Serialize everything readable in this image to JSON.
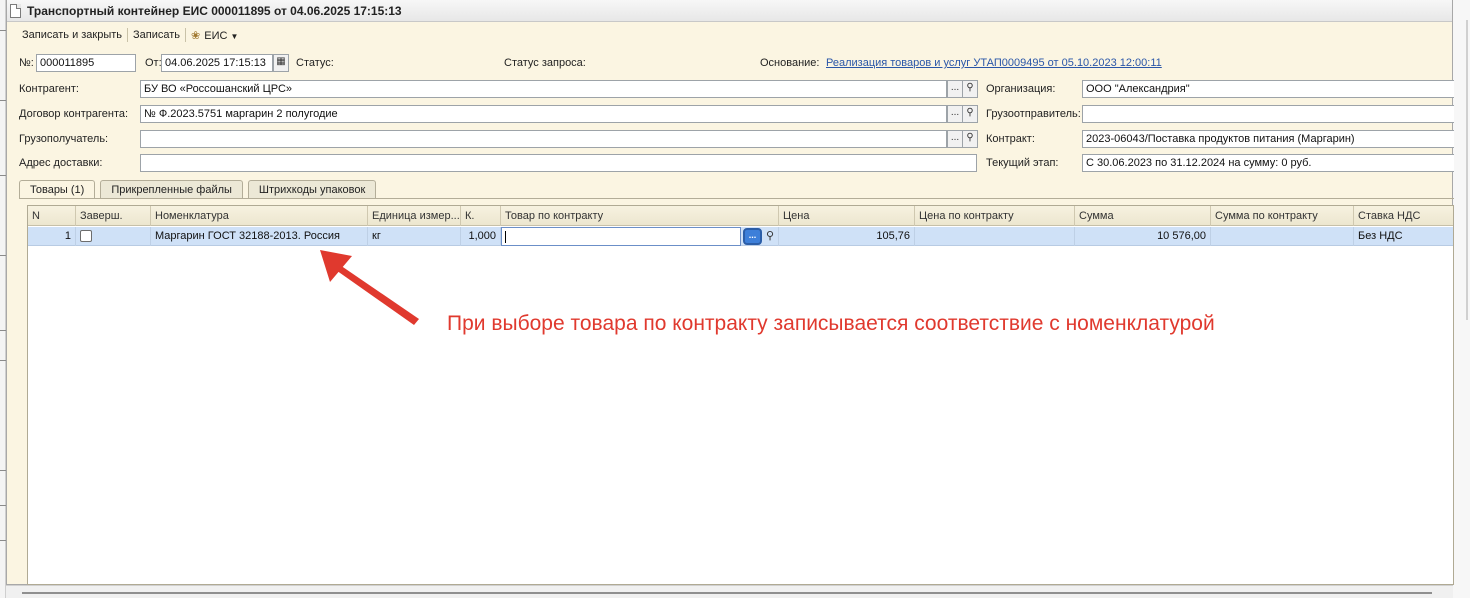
{
  "window": {
    "title": "Транспортный контейнер ЕИС 000011895 от 04.06.2025 17:15:13"
  },
  "toolbar": {
    "save_close": "Записать и закрыть",
    "save": "Записать",
    "eis": "ЕИС",
    "eis_icon": "eagle-icon"
  },
  "header": {
    "number_label": "№:",
    "number_value": "000011895",
    "date_label": "От:",
    "date_value": "04.06.2025 17:15:13",
    "status_label": "Статус:",
    "request_status_label": "Статус запроса:",
    "basis_label": "Основание:",
    "basis_link": "Реализация товаров и услуг УТАП0009495 от 05.10.2023 12:00:11"
  },
  "form": {
    "counterparty_label": "Контрагент:",
    "counterparty_value": "БУ ВО «Россошанский ЦРС»",
    "contract_cp_label": "Договор контрагента:",
    "contract_cp_value": "№ Ф.2023.5751 маргарин 2 полугодие",
    "consignee_label": "Грузополучатель:",
    "consignee_value": "",
    "address_label": "Адрес доставки:",
    "address_value": "",
    "org_label": "Организация:",
    "org_value": "ООО \"Александрия\"",
    "shipper_label": "Грузоотправитель:",
    "shipper_value": "",
    "contract_label": "Контракт:",
    "contract_value": "2023-06043/Поставка продуктов питания (Маргарин)",
    "stage_label": "Текущий этап:",
    "stage_value": "С 30.06.2023 по 31.12.2024 на сумму: 0 руб."
  },
  "tabs": [
    {
      "label": "Товары (1)",
      "active": true
    },
    {
      "label": "Прикрепленные файлы",
      "active": false
    },
    {
      "label": "Штрихкоды упаковок",
      "active": false
    }
  ],
  "table": {
    "columns": [
      "N",
      "Заверш.",
      "Номенклатура",
      "Единица измер...",
      "К.",
      "Товар по контракту",
      "Цена",
      "Цена по контракту",
      "Сумма",
      "Сумма по контракту",
      "Ставка НДС"
    ],
    "rows": [
      {
        "n": "1",
        "done": false,
        "nomenclature": "Маргарин  ГОСТ 32188-2013. Россия",
        "unit": "кг",
        "qty": "1,000",
        "contract_item": "",
        "price": "105,76",
        "contract_price": "",
        "sum": "10 576,00",
        "contract_sum": "",
        "vat": "Без НДС"
      }
    ]
  },
  "annotation": {
    "text": "При выборе товара по контракту записывается соответствие с номенклатурой",
    "color": "#e0392e"
  }
}
